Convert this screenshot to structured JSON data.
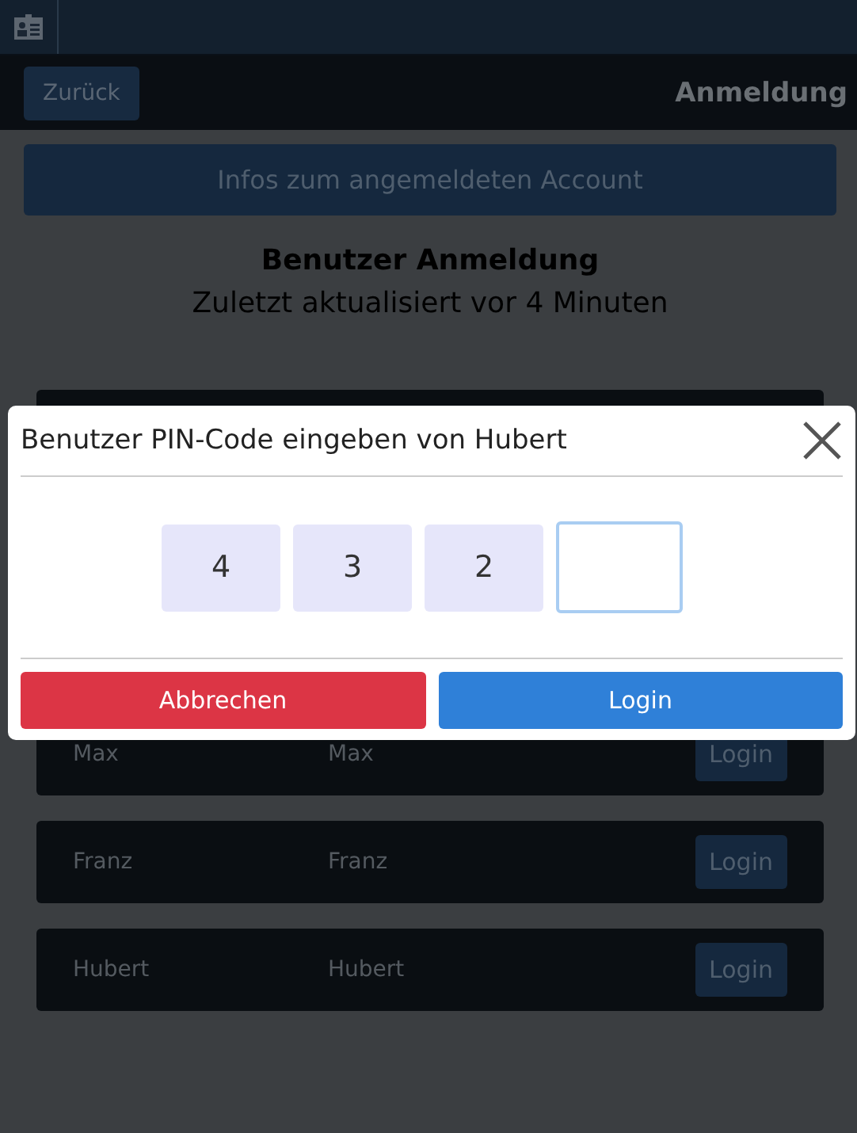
{
  "header": {
    "back_button": "Zurück",
    "title": "Anmeldung"
  },
  "info_button": "Infos zum angemeldeten Account",
  "heading": "Benutzer Anmeldung",
  "subtitle": "Zuletzt aktualisiert vor 4 Minuten",
  "users": [
    {
      "name": "Max",
      "display_name": "Max",
      "button": "Login"
    },
    {
      "name": "Franz",
      "display_name": "Franz",
      "button": "Login"
    },
    {
      "name": "Hubert",
      "display_name": "Hubert",
      "button": "Login"
    }
  ],
  "dialog": {
    "title": "Benutzer PIN-Code eingeben von Hubert",
    "pin_fields": [
      {
        "value": "4",
        "focused": false
      },
      {
        "value": "3",
        "focused": false
      },
      {
        "value": "2",
        "focused": false
      },
      {
        "focused": true
      }
    ],
    "cancel_button": "Abbrechen",
    "confirm_button": "Login"
  }
}
